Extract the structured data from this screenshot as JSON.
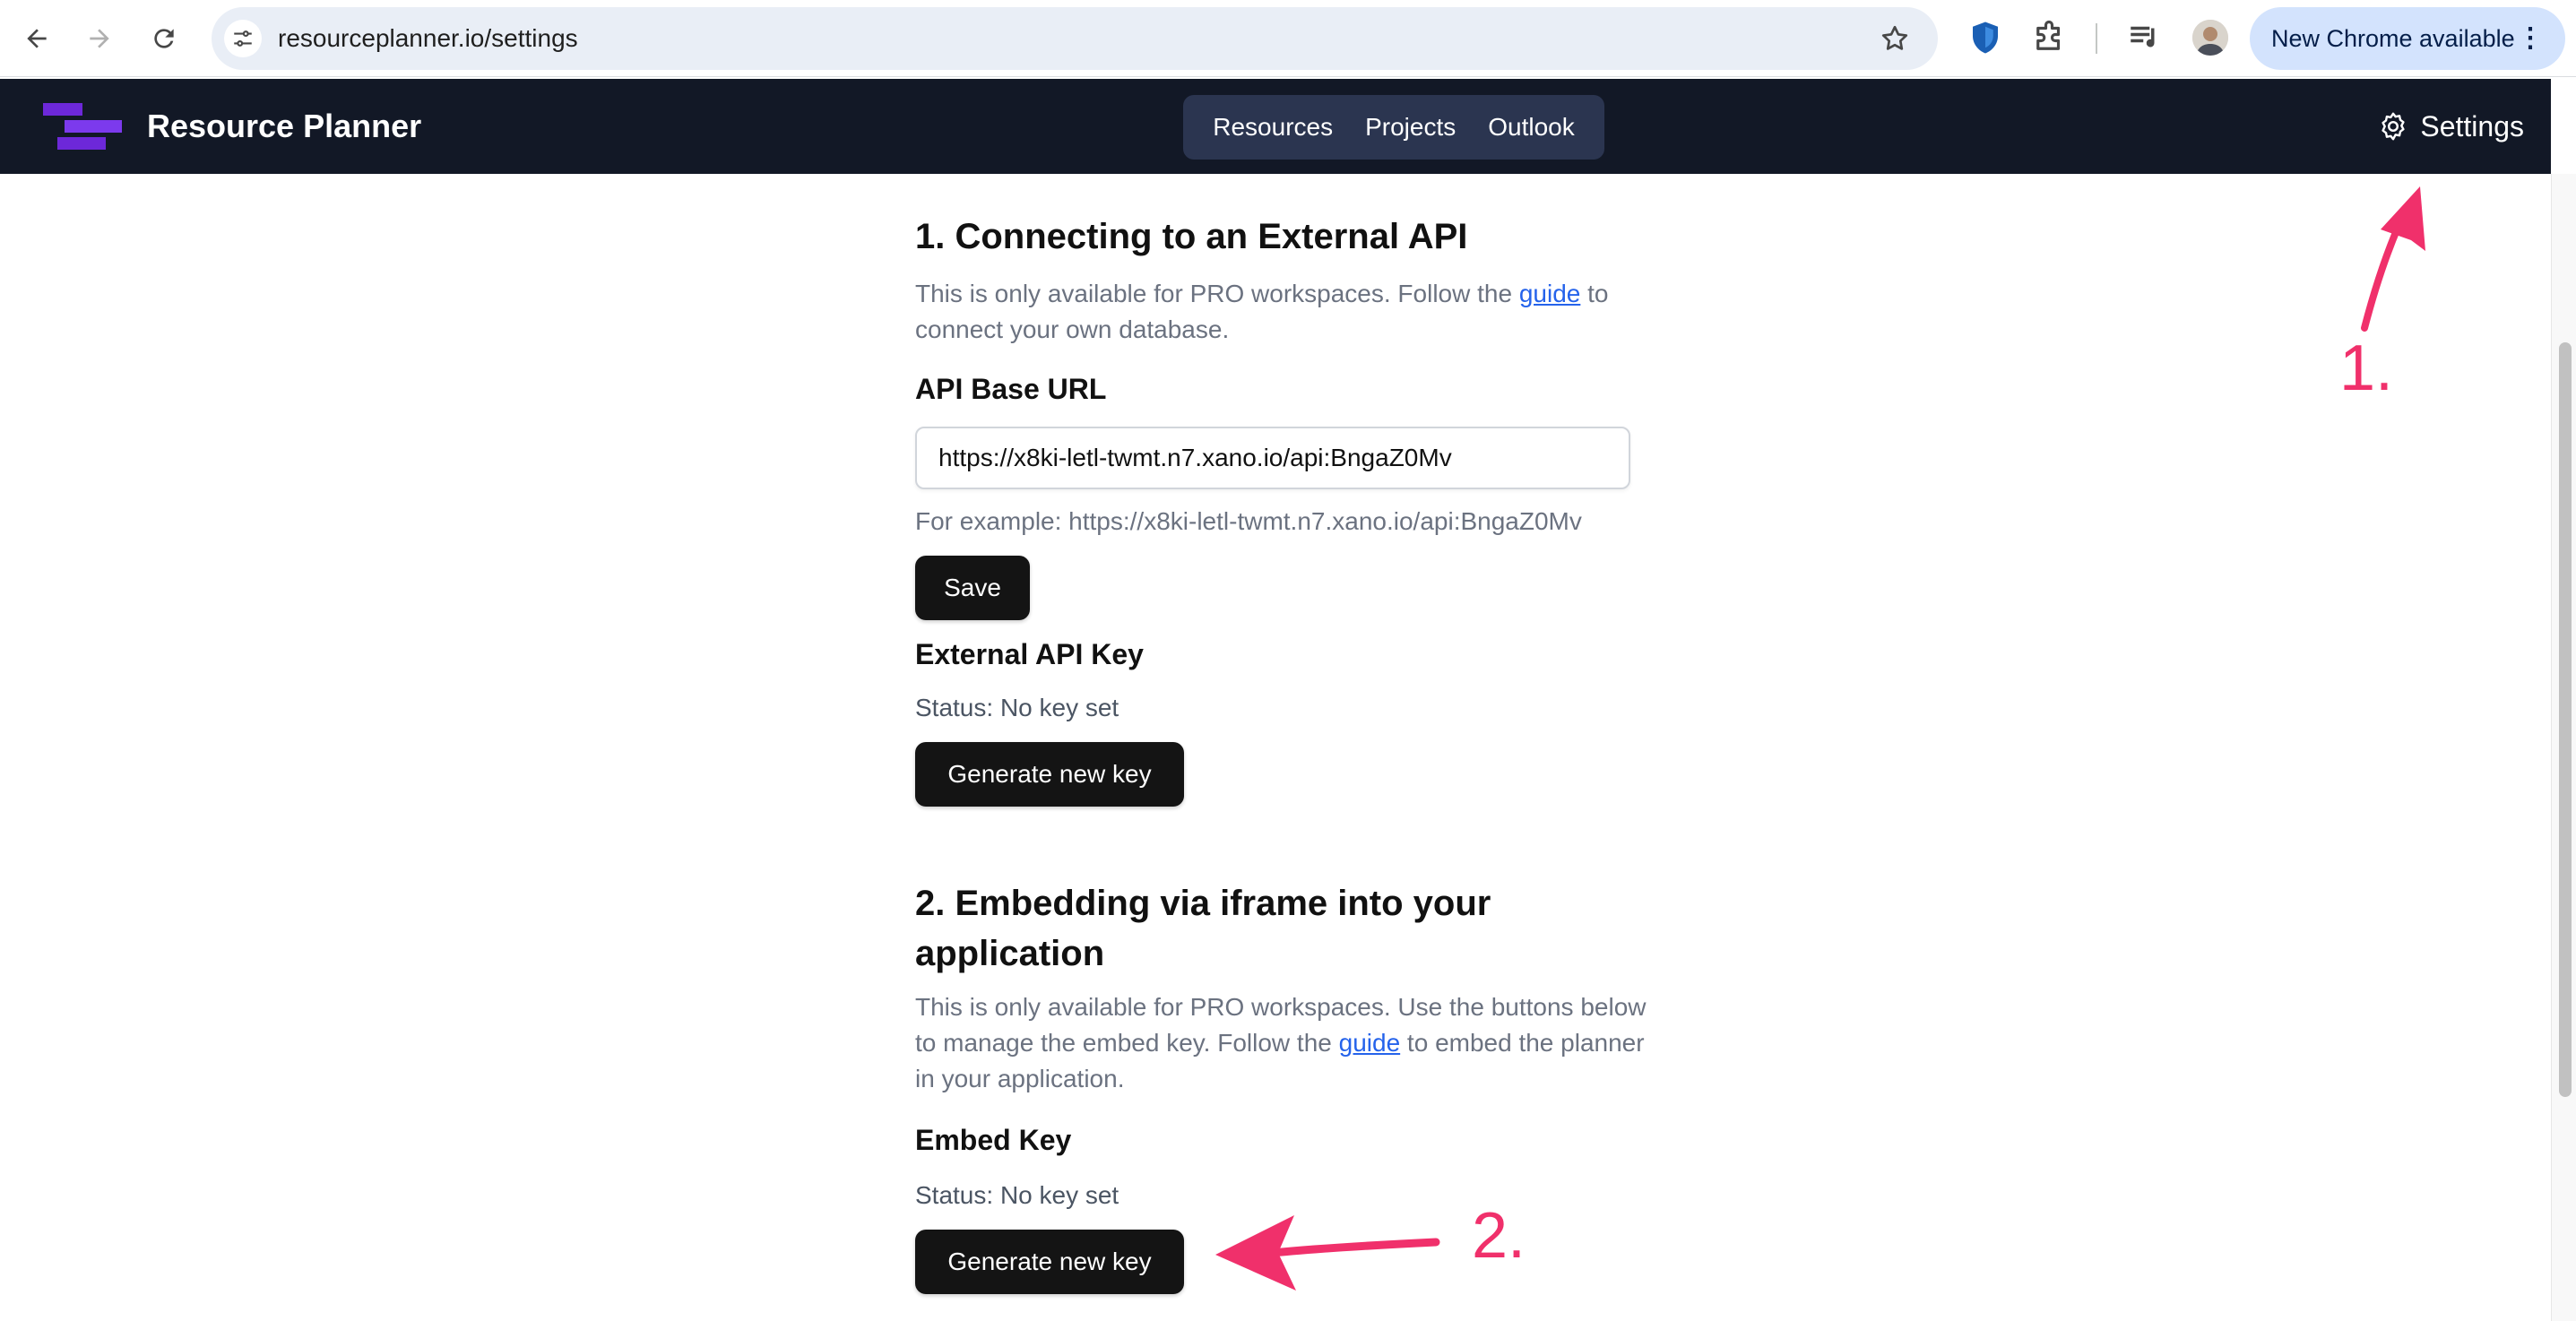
{
  "browser": {
    "url": "resourceplanner.io/settings",
    "update_label": "New Chrome available",
    "update_menu": "⋮"
  },
  "app": {
    "title": "Resource Planner",
    "nav": [
      {
        "label": "Resources"
      },
      {
        "label": "Projects"
      },
      {
        "label": "Outlook"
      }
    ],
    "settings_label": "Settings"
  },
  "section1": {
    "heading": "1. Connecting to an External API",
    "desc_before": "This is only available for PRO workspaces. Follow the ",
    "desc_link": "guide",
    "desc_after": " to connect your own database.",
    "api_base_label": "API Base URL",
    "api_base_value": "https://x8ki-letl-twmt.n7.xano.io/api:BngaZ0Mv",
    "api_base_hint": "For example: https://x8ki-letl-twmt.n7.xano.io/api:BngaZ0Mv",
    "save_label": "Save",
    "key_label": "External API Key",
    "key_status": "Status: No key set",
    "generate_label": "Generate new key"
  },
  "section2": {
    "heading_line1": "2. Embedding via iframe into your",
    "heading_line2": "application",
    "desc_before": "This is only available for PRO workspaces. Use the buttons below to manage the embed key. Follow the ",
    "desc_link": "guide",
    "desc_after": " to embed the planner in your application.",
    "key_label": "Embed Key",
    "key_status": "Status: No key set",
    "generate_label": "Generate new key"
  },
  "annotations": {
    "step1": "1.",
    "step2": "2.",
    "color": "#f0306b"
  },
  "colors": {
    "header_bg": "#121826",
    "nav_group_bg": "#2b3550",
    "button_bg": "#141414",
    "link": "#2563eb",
    "logo_purple": "#6d28d9"
  }
}
